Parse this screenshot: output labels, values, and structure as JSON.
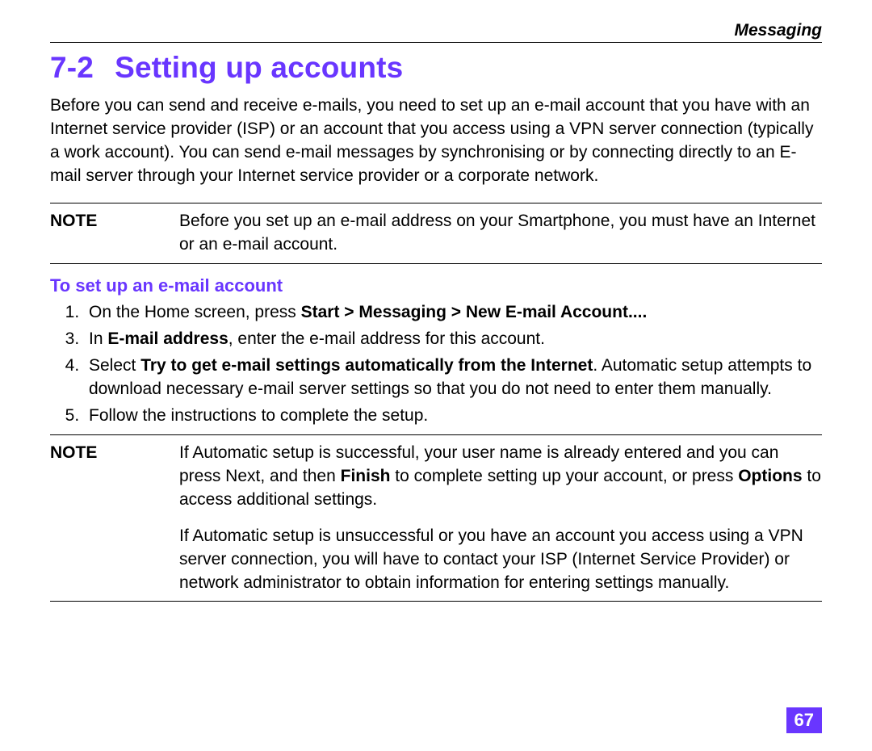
{
  "header": {
    "chapter": "Messaging"
  },
  "section": {
    "number": "7-2",
    "title": "Setting up accounts"
  },
  "intro": "Before you can send and receive e-mails, you need to set up an e-mail account that you have with an Internet service provider (ISP) or an account that you access using a VPN server connection (typically a work account). You can send e-mail messages by synchronising or by connecting directly to an E-mail server through your Internet service provider or a corporate network.",
  "note1": {
    "label": "NOTE",
    "text": "Before you set up an e-mail address on your Smartphone, you must have an Internet or an e-mail account."
  },
  "subheading": "To set up an e-mail account",
  "steps": {
    "s1_pre": "On the Home screen, press ",
    "s1_bold": "Start  > Messaging > New E-mail Account....",
    "s3_pre": "In ",
    "s3_bold": "E-mail address",
    "s3_post": ", enter the e-mail address for this account.",
    "s4_pre": "Select ",
    "s4_bold": "Try to get e-mail settings automatically from the Internet",
    "s4_post": ". Automatic setup attempts to download necessary e-mail server settings so that you do not need to enter them manually.",
    "s5": "Follow the instructions to complete the setup."
  },
  "note2": {
    "label": "NOTE",
    "p1_pre": "If Automatic setup is successful, your user name is already entered and you can press Next, and then ",
    "p1_b1": "Finish",
    "p1_mid": " to complete setting up your account, or press ",
    "p1_b2": "Options",
    "p1_post": " to access additional settings.",
    "p2": "If Automatic setup is unsuccessful or you have an account you access using a VPN server connection, you will have to contact your ISP (Internet Service Provider) or network administrator to obtain information for entering settings manually."
  },
  "pagenum": "67"
}
